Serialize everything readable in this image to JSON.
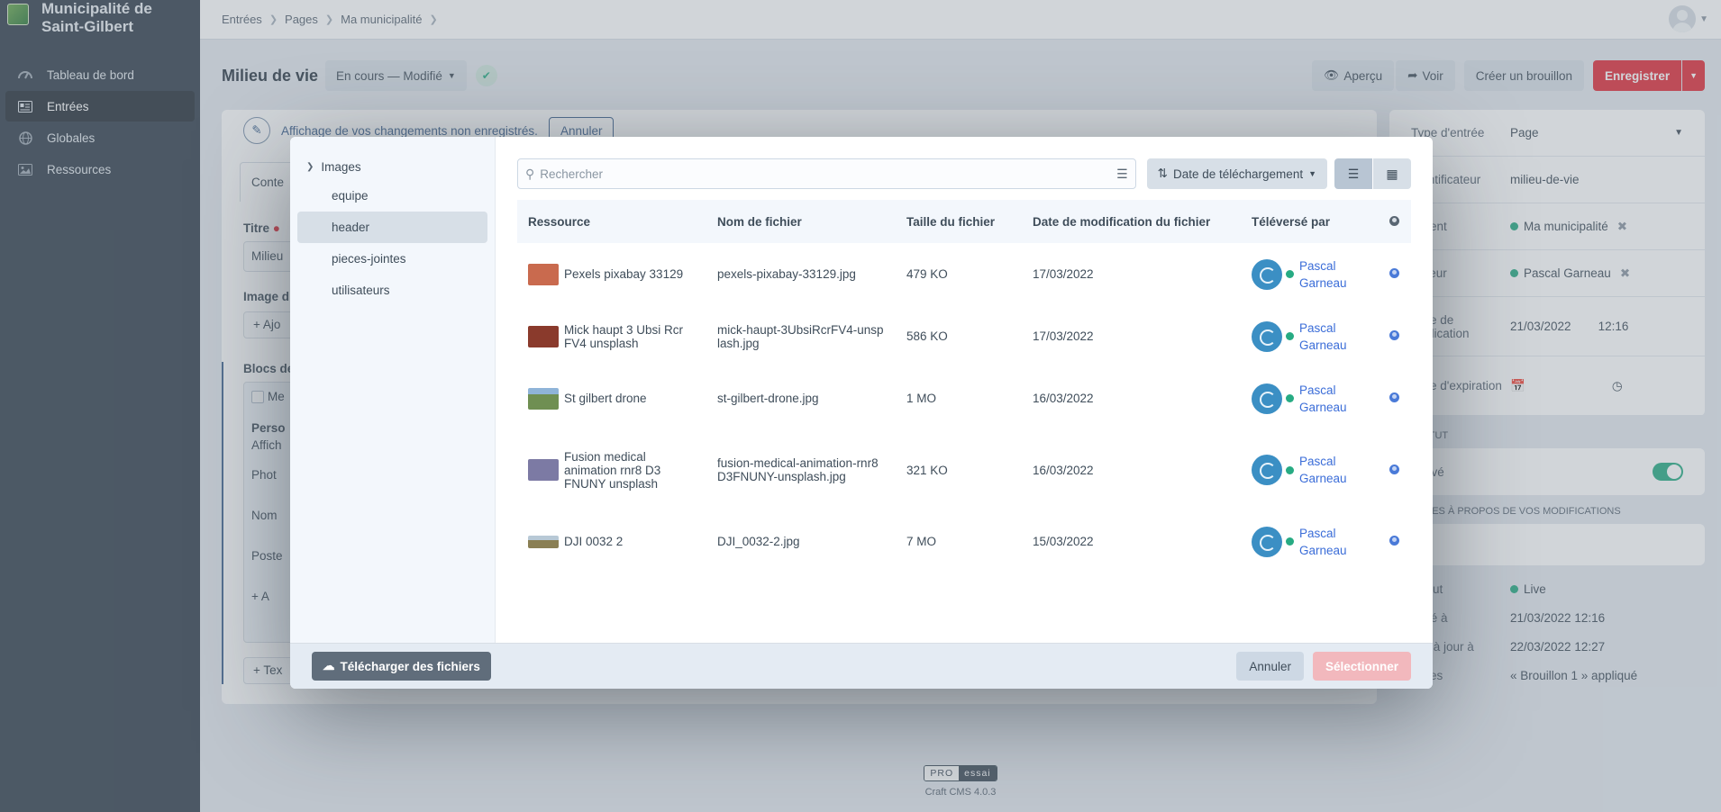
{
  "site": {
    "name": "Municipalité de Saint-Gilbert"
  },
  "nav": [
    {
      "label": "Tableau de bord",
      "icon": "gauge-icon",
      "active": false
    },
    {
      "label": "Entrées",
      "icon": "newspaper-icon",
      "active": true
    },
    {
      "label": "Globales",
      "icon": "globe-icon",
      "active": false
    },
    {
      "label": "Ressources",
      "icon": "image-icon",
      "active": false
    }
  ],
  "breadcrumbs": [
    "Entrées",
    "Pages",
    "Ma municipalité"
  ],
  "page": {
    "title": "Milieu de vie",
    "status": "En cours — Modifié",
    "preview": "Aperçu",
    "view": "Voir",
    "create_draft": "Créer un brouillon",
    "save": "Enregistrer"
  },
  "notice": {
    "text": "Affichage de vos changements non enregistrés.",
    "cancel": "Annuler"
  },
  "content": {
    "tab": "Conte",
    "title_label": "Titre",
    "title_value": "Milieu",
    "image_label": "Image d",
    "add_label": "Ajo",
    "blocks_label": "Blocs de",
    "block_check": "Me",
    "perso_label": "Perso",
    "affich_label": "Affich",
    "photo_label": "Phot",
    "nom_label": "Nom",
    "poste_label": "Poste",
    "add_a": "A",
    "add_tex": "Tex"
  },
  "meta": [
    {
      "k": "Type d'entrée",
      "v": "Page"
    },
    {
      "k": "Identificateur",
      "v": "milieu-de-vie"
    },
    {
      "k": "Parent",
      "v": "Ma municipalité"
    },
    {
      "k": "Auteur",
      "v": "Pascal Garneau"
    },
    {
      "k": "Date de publication",
      "v": "21/03/2022",
      "v2": "12:16"
    },
    {
      "k": "Date d'expiration",
      "v": ""
    }
  ],
  "status_section": {
    "heading": "STATUT",
    "enabled_label": "Activé",
    "notes_heading": "NOTES À PROPOS DE VOS MODIFICATIONS",
    "rows": [
      {
        "k": "Statut",
        "v": "Live"
      },
      {
        "k": "Créé à",
        "v": "21/03/2022 12:16"
      },
      {
        "k": "Mis à jour à",
        "v": "22/03/2022 12:27"
      },
      {
        "k": "Notes",
        "v": "« Brouillon 1 » appliqué"
      }
    ]
  },
  "footer": {
    "pro": "PRO",
    "essai": "essai",
    "version": "Craft CMS 4.0.3"
  },
  "modal": {
    "sources_root": "Images",
    "sources": [
      "equipe",
      "header",
      "pieces-jointes",
      "utilisateurs"
    ],
    "selected_source": "header",
    "search_placeholder": "Rechercher",
    "sort_label": "Date de téléchargement",
    "columns": [
      "Ressource",
      "Nom de fichier",
      "Taille du fichier",
      "Date de modification du fichier",
      "Téléversé par"
    ],
    "rows": [
      {
        "title": "Pexels pixabay 33129",
        "file": "pexels-pixabay-33129.jpg",
        "size": "479 KO",
        "date": "17/03/2022",
        "by": "Pascal Garneau",
        "thumb": "#c96a4e"
      },
      {
        "title": "Mick haupt 3 Ubsi Rcr FV4 unsplash",
        "file": "mick-haupt-3UbsiRcrFV4-unsplash.jpg",
        "size": "586 KO",
        "date": "17/03/2022",
        "by": "Pascal Garneau",
        "thumb": "#8a3a2c"
      },
      {
        "title": "St gilbert drone",
        "file": "st-gilbert-drone.jpg",
        "size": "1 MO",
        "date": "16/03/2022",
        "by": "Pascal Garneau",
        "thumb": "#6f8f52"
      },
      {
        "title": "Fusion medical animation rnr8 D3 FNUNY unsplash",
        "file": "fusion-medical-animation-rnr8D3FNUNY-unsplash.jpg",
        "size": "321 KO",
        "date": "16/03/2022",
        "by": "Pascal Garneau",
        "thumb": "#7c7aa4"
      },
      {
        "title": "DJI 0032 2",
        "file": "DJI_0032-2.jpg",
        "size": "7 MO",
        "date": "15/03/2022",
        "by": "Pascal Garneau",
        "thumb": "#8a7f54"
      }
    ],
    "upload_label": "Télécharger des fichiers",
    "cancel_label": "Annuler",
    "select_label": "Sélectionner"
  }
}
